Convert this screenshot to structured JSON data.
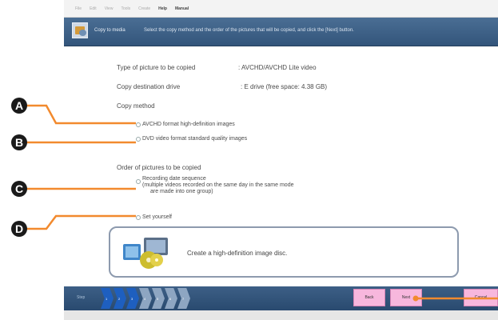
{
  "menu": {
    "items": [
      {
        "label": "File"
      },
      {
        "label": "Edit"
      },
      {
        "label": "View"
      },
      {
        "label": "Tools"
      },
      {
        "label": "Create"
      },
      {
        "label": "Help"
      },
      {
        "label": "Manual"
      }
    ]
  },
  "header": {
    "title": "Copy to media",
    "instruction": "Select the copy method and the order of the pictures that will be copied, and click the [Next] button."
  },
  "form": {
    "type_label": "Type of picture to be copied",
    "type_value": ":  AVCHD/AVCHD Lite video",
    "dest_label": "Copy destination drive",
    "dest_value": ":  E drive (free space: 4.38 GB)",
    "method_label": "Copy method",
    "method_options": [
      {
        "label": "AVCHD format high-definition images"
      },
      {
        "label": "DVD video format standard quality images"
      }
    ],
    "order_label": "Order of pictures to be copied",
    "order_options": [
      {
        "line1": "Recording date sequence",
        "line2": "(multiple videos recorded on the same day in the same mode",
        "line3": "are made into one group)"
      },
      {
        "line1": "Set yourself"
      }
    ]
  },
  "info": {
    "text": "Create a high-definition image disc."
  },
  "steps": {
    "label": "Step",
    "items": [
      {
        "num": "1"
      },
      {
        "num": "2"
      },
      {
        "num": "3"
      },
      {
        "num": "4"
      },
      {
        "num": "5"
      },
      {
        "num": "6"
      },
      {
        "num": "7"
      }
    ]
  },
  "buttons": {
    "back": "Back",
    "next": "Next",
    "cancel": "Cancel"
  },
  "callouts": [
    "A",
    "B",
    "C",
    "D"
  ],
  "colors": {
    "header_bg": "#3d6189",
    "button_pink": "#f7b7dd",
    "callout_line": "#f28a2e",
    "step_active": "#1e5fbf"
  }
}
